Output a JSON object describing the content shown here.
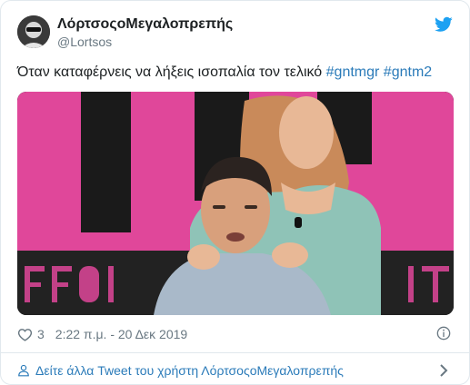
{
  "author": {
    "display_name": "ΛόρτσοςοΜεγαλοπρεπής",
    "handle": "@Lortsos"
  },
  "tweet": {
    "text": "Όταν καταφέρνεις να λήξεις ισοπαλία τον τελικό ",
    "hashtags": [
      "#gntmgr",
      "#gntm2"
    ]
  },
  "media": {
    "description_icon": "photo-frame"
  },
  "meta": {
    "likes": "3",
    "timestamp": "2:22 π.μ. - 20 Δεκ 2019"
  },
  "footer": {
    "more_link": "Δείτε άλλα Tweet του χρήστη ΛόρτσοςοΜεγαλοπρεπής"
  },
  "colors": {
    "accent": "#1da1f2",
    "link": "#2b7bb9",
    "muted": "#697882"
  }
}
